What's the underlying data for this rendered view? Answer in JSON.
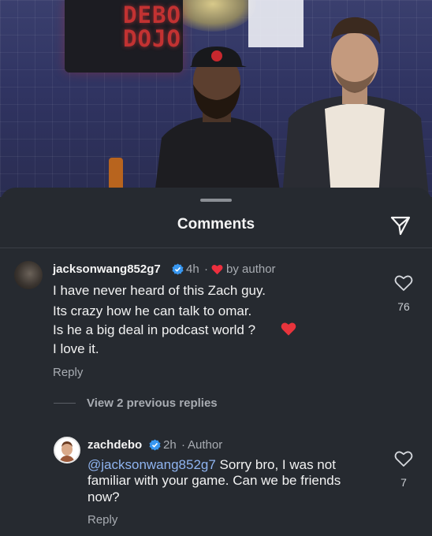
{
  "background": {
    "sign_line1": "DEBO",
    "sign_line2": "DOJO"
  },
  "sheet": {
    "title": "Comments",
    "share_icon": "paper-plane-icon"
  },
  "comments": [
    {
      "username": "jacksonwang852g7",
      "time": "4h",
      "separator": "·",
      "liked_by_author": "by author",
      "lines": [
        "I have never heard of this Zach guy.",
        "Its crazy how he can talk to omar.",
        "Is he a big deal in podcast world ?",
        "I love it."
      ],
      "reply_label": "Reply",
      "like_count": "76",
      "view_replies": "View 2 previous replies"
    },
    {
      "username": "zachdebo",
      "time": "2h",
      "separator": "·",
      "role": "Author",
      "mention": "@jacksonwang852g7",
      "line1_rest": " Sorry bro, I was not",
      "line2": "familiar with your game. Can we be friends",
      "line3": "now?",
      "reply_label": "Reply",
      "like_count": "7"
    }
  ],
  "colors": {
    "sheet_bg": "#262a30",
    "verified_blue": "#3897f0",
    "heart_red": "#ed2f3e",
    "secondary_text": "#a8acb2",
    "mention_blue": "#8fb4f0"
  }
}
